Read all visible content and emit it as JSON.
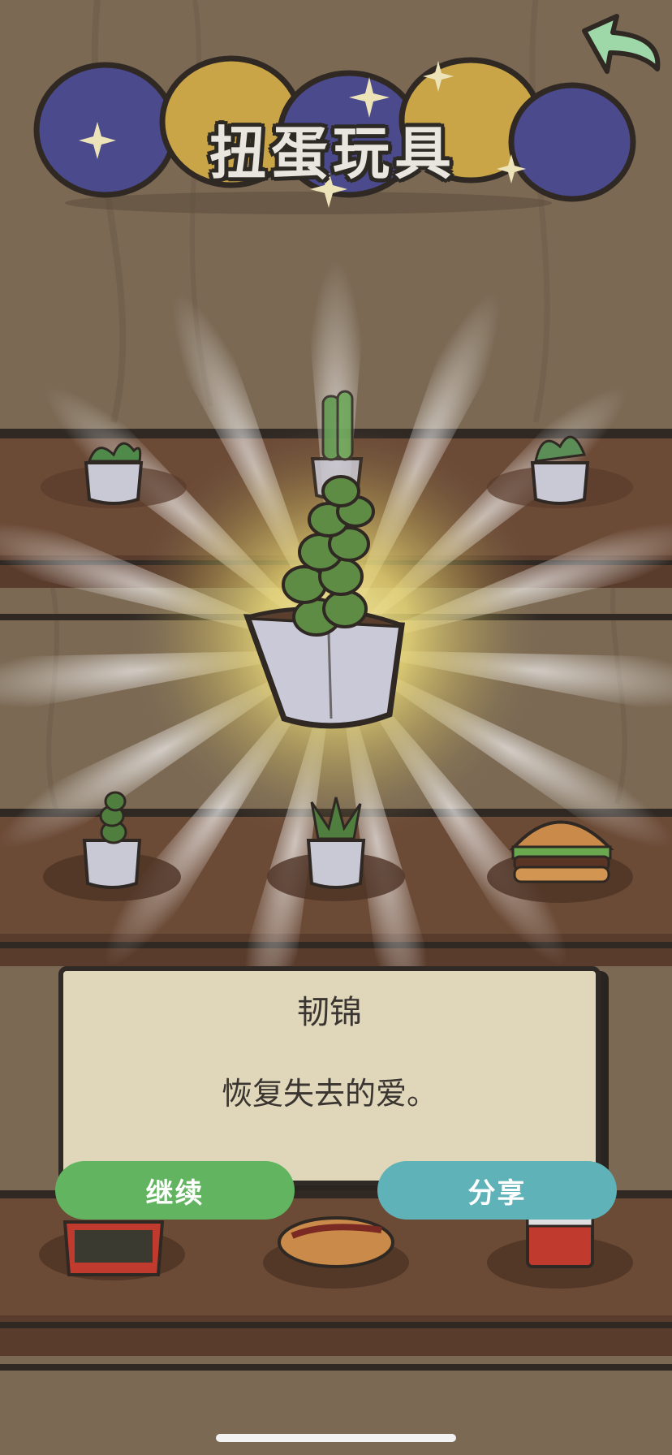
{
  "header": {
    "title": "扭蛋玩具",
    "back_icon": "back-arrow-icon"
  },
  "result_card": {
    "item_name": "韧锦",
    "item_description": "恢复失去的爱。"
  },
  "actions": {
    "continue_label": "继续",
    "share_label": "分享"
  },
  "colors": {
    "background": "#7c6a55",
    "shelf": "#6b4a36",
    "card_background": "#e0d7bb",
    "continue_button": "#62b460",
    "share_button": "#5fb2b8",
    "capsule_blue": "#4a4a8c",
    "capsule_gold": "#c9a548",
    "back_arrow": "#9fd8a8"
  }
}
